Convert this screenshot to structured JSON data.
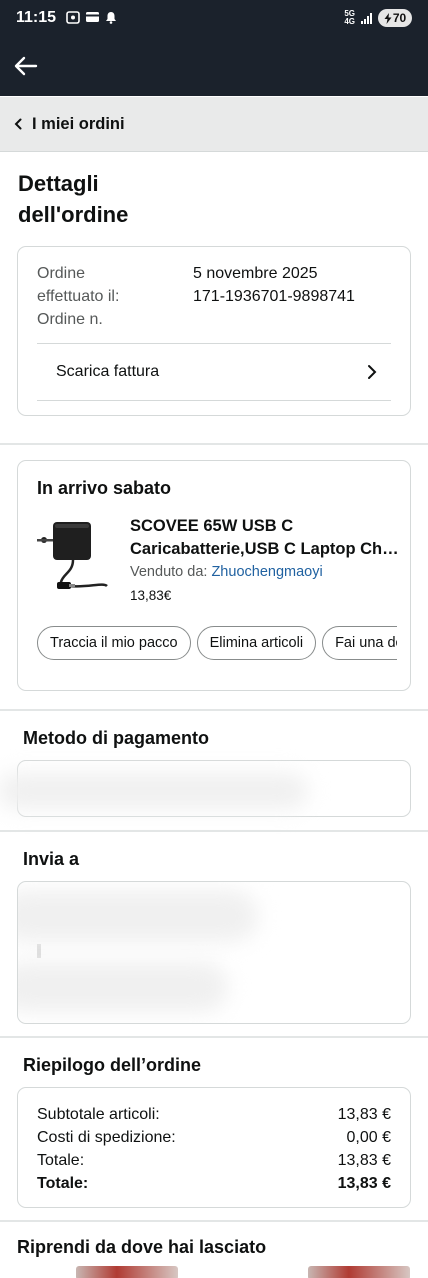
{
  "status_bar": {
    "time": "11:15",
    "network": [
      "5G",
      "4G"
    ],
    "battery": "70",
    "icons": [
      "screenshot-icon",
      "card-icon",
      "notification-bell-icon",
      "signal-icon",
      "battery-charging-icon"
    ]
  },
  "app_bar": {
    "back_icon": "arrow-left-icon"
  },
  "breadcrumb": {
    "label": "I miei ordini"
  },
  "page": {
    "title_line1": "Dettagli",
    "title_line2": "dell'ordine"
  },
  "order_info": {
    "label_line1": "Ordine",
    "label_line2": "effettuato il:",
    "label_line3": "Ordine n.",
    "date": "5 novembre 2025",
    "order_number": "171-1936701-9898741",
    "invoice_label": "Scarica fattura"
  },
  "delivery": {
    "status": "In arrivo sabato",
    "product": {
      "name_line1": "SCOVEE 65W USB C",
      "name_line2": "Caricabatterie,USB C Laptop Charger",
      "sold_by_label": "Venduto da:",
      "seller": "Zhuochengmaoyi",
      "price": "13,83€"
    },
    "actions": [
      "Traccia il mio pacco",
      "Elimina articoli",
      "Fai una domanda sul prodotto"
    ]
  },
  "payment": {
    "title": "Metodo di pagamento"
  },
  "ship_to": {
    "title": "Invia a"
  },
  "summary": {
    "title": "Riepilogo dell’ordine",
    "rows": [
      {
        "label": "Subtotale articoli:",
        "value": "13,83 €"
      },
      {
        "label": "Costi di spedizione:",
        "value": "0,00 €"
      },
      {
        "label": "Totale:",
        "value": "13,83 €"
      },
      {
        "label": "Totale:",
        "value": "13,83 €"
      }
    ]
  },
  "resume": {
    "title": "Riprendi da dove hai lasciato"
  },
  "colors": {
    "header_bg": "#1b222c",
    "link": "#2162a1",
    "breadcrumb_bg": "#e9eaea",
    "border": "#d5d9d9"
  }
}
